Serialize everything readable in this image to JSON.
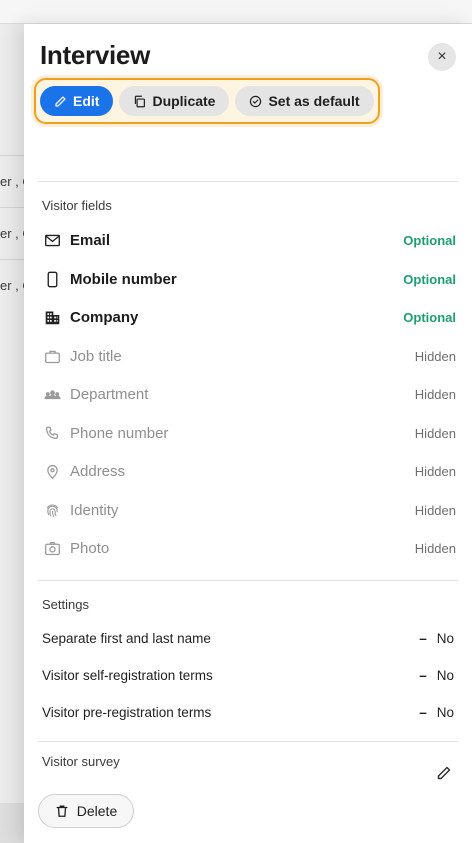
{
  "background": {
    "row_fragments": [
      "er , C",
      "er , C",
      "er , C"
    ]
  },
  "drawer": {
    "title": "Interview",
    "close_glyph": "×",
    "toolbar": {
      "edit_label": "Edit",
      "duplicate_label": "Duplicate",
      "default_label": "Set as default"
    },
    "visitor_fields": {
      "heading": "Visitor fields",
      "items": [
        {
          "label": "Email",
          "status": "Optional",
          "icon": "mail-icon"
        },
        {
          "label": "Mobile number",
          "status": "Optional",
          "icon": "phone-device-icon"
        },
        {
          "label": "Company",
          "status": "Optional",
          "icon": "building-icon"
        },
        {
          "label": "Job title",
          "status": "Hidden",
          "icon": "briefcase-icon"
        },
        {
          "label": "Department",
          "status": "Hidden",
          "icon": "group-icon"
        },
        {
          "label": "Phone number",
          "status": "Hidden",
          "icon": "phone-icon"
        },
        {
          "label": "Address",
          "status": "Hidden",
          "icon": "location-icon"
        },
        {
          "label": "Identity",
          "status": "Hidden",
          "icon": "fingerprint-icon"
        },
        {
          "label": "Photo",
          "status": "Hidden",
          "icon": "camera-icon"
        }
      ]
    },
    "settings": {
      "heading": "Settings",
      "items": [
        {
          "label": "Separate first and last name",
          "value": "No"
        },
        {
          "label": "Visitor self-registration terms",
          "value": "No"
        },
        {
          "label": "Visitor pre-registration terms",
          "value": "No"
        }
      ]
    },
    "survey": {
      "heading": "Visitor survey"
    },
    "delete_label": "Delete"
  },
  "colors": {
    "primary": "#1a73e8",
    "optional": "#1e9e73",
    "highlight": "#f0a020"
  }
}
